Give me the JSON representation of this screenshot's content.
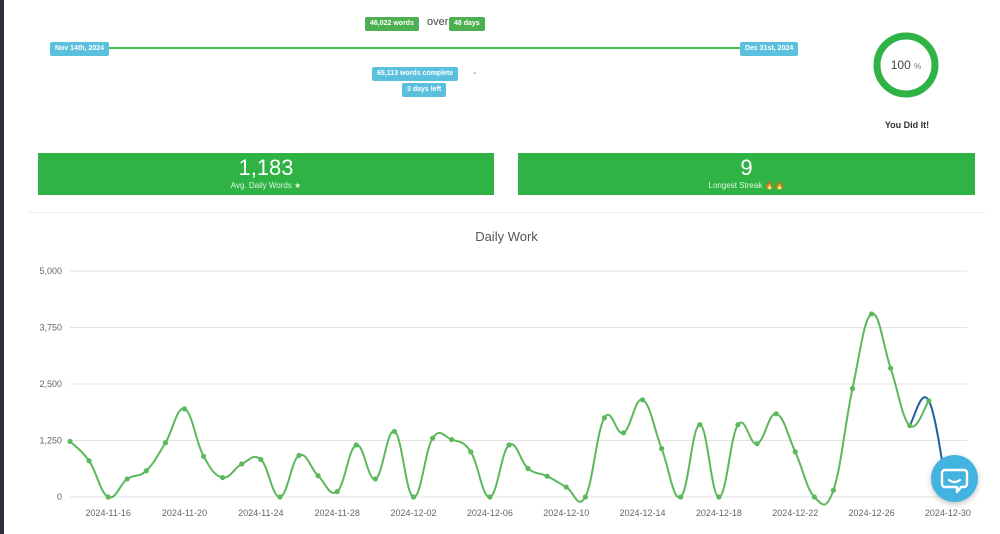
{
  "timeline": {
    "start_date": "Nov 14th, 2024",
    "end_date": "Dec 31st, 2024",
    "words_goal": "46,022 words",
    "over": "over",
    "days": "48 days",
    "words_complete": "65,113 words complete",
    "dash": "-",
    "days_left": "3 days left"
  },
  "progress": {
    "percent_value": "100",
    "percent_sign": "%",
    "caption": "You Did It!",
    "fraction": 1.0
  },
  "stats": {
    "avg_daily_value": "1,183",
    "avg_daily_label": "Avg. Daily Words ★",
    "streak_value": "9",
    "streak_label": "Longest Streak 🔥🔥"
  },
  "colors": {
    "accent_green": "#2fb344",
    "line_green": "#5cb85c",
    "line_blue": "#1f5f9e",
    "pill_blue": "#5bc0de"
  },
  "chart_data": {
    "type": "line",
    "title": "Daily Work",
    "xlabel": "",
    "ylabel": "",
    "ylim": [
      0,
      5000
    ],
    "y_ticks": [
      "0",
      "1,250",
      "2,500",
      "3,750",
      "5,000"
    ],
    "y_tick_values": [
      0,
      1250,
      2500,
      3750,
      5000
    ],
    "x_ticks": [
      "2024-11-16",
      "2024-11-20",
      "2024-11-24",
      "2024-11-28",
      "2024-12-02",
      "2024-12-06",
      "2024-12-10",
      "2024-12-14",
      "2024-12-18",
      "2024-12-22",
      "2024-12-26",
      "2024-12-30"
    ],
    "x": [
      "2024-11-14",
      "2024-11-15",
      "2024-11-16",
      "2024-11-17",
      "2024-11-18",
      "2024-11-19",
      "2024-11-20",
      "2024-11-21",
      "2024-11-22",
      "2024-11-23",
      "2024-11-24",
      "2024-11-25",
      "2024-11-26",
      "2024-11-27",
      "2024-11-28",
      "2024-11-29",
      "2024-11-30",
      "2024-12-01",
      "2024-12-02",
      "2024-12-03",
      "2024-12-04",
      "2024-12-05",
      "2024-12-06",
      "2024-12-07",
      "2024-12-08",
      "2024-12-09",
      "2024-12-10",
      "2024-12-11",
      "2024-12-12",
      "2024-12-13",
      "2024-12-14",
      "2024-12-15",
      "2024-12-16",
      "2024-12-17",
      "2024-12-18",
      "2024-12-19",
      "2024-12-20",
      "2024-12-21",
      "2024-12-22",
      "2024-12-23",
      "2024-12-24",
      "2024-12-25",
      "2024-12-26",
      "2024-12-27",
      "2024-12-28",
      "2024-12-29",
      "2024-12-30",
      "2024-12-31"
    ],
    "series": [
      {
        "values": [
          1230,
          800,
          0,
          400,
          580,
          1200,
          1950,
          900,
          430,
          730,
          830,
          0,
          920,
          470,
          120,
          1150,
          400,
          1450,
          0,
          1300,
          1270,
          1000,
          0,
          1150,
          630,
          460,
          220,
          0,
          1750,
          1420,
          2150,
          1070,
          0,
          1600,
          0,
          1600,
          1180,
          1840,
          1000,
          0,
          150,
          2400,
          4050,
          2850,
          1580,
          2130,
          null,
          null
        ],
        "color": "#5cb85c"
      },
      {
        "values": [
          null,
          null,
          null,
          null,
          null,
          null,
          null,
          null,
          null,
          null,
          null,
          null,
          null,
          null,
          null,
          null,
          null,
          null,
          null,
          null,
          null,
          null,
          null,
          null,
          null,
          null,
          null,
          null,
          null,
          null,
          null,
          null,
          null,
          null,
          null,
          null,
          null,
          null,
          null,
          null,
          null,
          null,
          null,
          null,
          1580,
          2130,
          0,
          null
        ],
        "color": "#1f5f9e"
      }
    ]
  }
}
